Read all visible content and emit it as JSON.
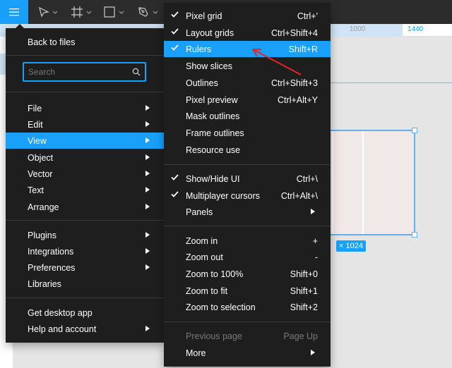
{
  "toolbar": {
    "menu_icon": "hamburger-menu-icon",
    "tools": [
      {
        "name": "move-tool",
        "icon": "cursor-arrow-icon"
      },
      {
        "name": "frame-tool",
        "icon": "frame-hash-icon"
      },
      {
        "name": "shape-tool",
        "icon": "rectangle-icon"
      },
      {
        "name": "pen-tool",
        "icon": "pen-nib-icon"
      }
    ]
  },
  "ruler": {
    "label_1000": "1000",
    "label_1440": "1440"
  },
  "canvas": {
    "frame_size_badge": "× 1024"
  },
  "main_menu": {
    "back_to_files": "Back to files",
    "search_placeholder": "Search",
    "items_group1": [
      {
        "label": "File",
        "submenu": true
      },
      {
        "label": "Edit",
        "submenu": true
      },
      {
        "label": "View",
        "submenu": true,
        "active": true
      },
      {
        "label": "Object",
        "submenu": true
      },
      {
        "label": "Vector",
        "submenu": true
      },
      {
        "label": "Text",
        "submenu": true
      },
      {
        "label": "Arrange",
        "submenu": true
      }
    ],
    "items_group2": [
      {
        "label": "Plugins",
        "submenu": true
      },
      {
        "label": "Integrations",
        "submenu": true
      },
      {
        "label": "Preferences",
        "submenu": true
      },
      {
        "label": "Libraries",
        "submenu": false
      }
    ],
    "items_group3": [
      {
        "label": "Get desktop app",
        "submenu": false
      },
      {
        "label": "Help and account",
        "submenu": true
      }
    ]
  },
  "view_menu": {
    "group1": [
      {
        "label": "Pixel grid",
        "shortcut": "Ctrl+'",
        "checked": true
      },
      {
        "label": "Layout grids",
        "shortcut": "Ctrl+Shift+4",
        "checked": true
      },
      {
        "label": "Rulers",
        "shortcut": "Shift+R",
        "checked": true,
        "active": true
      },
      {
        "label": "Show slices",
        "shortcut": "",
        "checked": false
      },
      {
        "label": "Outlines",
        "shortcut": "Ctrl+Shift+3",
        "checked": false
      },
      {
        "label": "Pixel preview",
        "shortcut": "Ctrl+Alt+Y",
        "checked": false
      },
      {
        "label": "Mask outlines",
        "shortcut": "",
        "checked": false
      },
      {
        "label": "Frame outlines",
        "shortcut": "",
        "checked": false
      },
      {
        "label": "Resource use",
        "shortcut": "",
        "checked": false
      }
    ],
    "group2": [
      {
        "label": "Show/Hide UI",
        "shortcut": "Ctrl+\\",
        "checked": true
      },
      {
        "label": "Multiplayer cursors",
        "shortcut": "Ctrl+Alt+\\",
        "checked": true
      },
      {
        "label": "Panels",
        "shortcut": "",
        "checked": false,
        "submenu": true
      }
    ],
    "group3": [
      {
        "label": "Zoom in",
        "shortcut": "+"
      },
      {
        "label": "Zoom out",
        "shortcut": "-"
      },
      {
        "label": "Zoom to 100%",
        "shortcut": "Shift+0"
      },
      {
        "label": "Zoom to fit",
        "shortcut": "Shift+1"
      },
      {
        "label": "Zoom to selection",
        "shortcut": "Shift+2"
      }
    ],
    "group4": [
      {
        "label": "Previous page",
        "shortcut": "Page Up",
        "disabled": true
      },
      {
        "label": "More",
        "shortcut": "",
        "submenu": true
      }
    ]
  },
  "colors": {
    "accent": "#18a0fb",
    "menu_bg": "#1e1e1e",
    "toolbar_bg": "#2c2c2c",
    "annotation_red": "#e0262b"
  }
}
